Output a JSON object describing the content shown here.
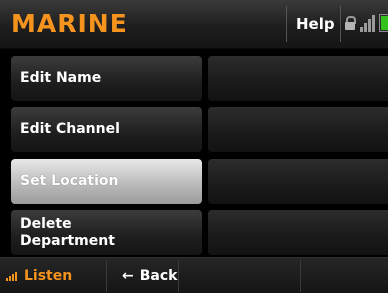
{
  "header": {
    "title": "MARINE",
    "help_label": "Help",
    "status_icons": [
      "lock-icon",
      "signal-icon",
      "battery-icon"
    ],
    "battery_level": 0.85
  },
  "menu": {
    "items": [
      {
        "label": "Edit Name",
        "selected": false
      },
      {
        "label": "Edit Channel",
        "selected": false
      },
      {
        "label": "Set Location",
        "selected": true
      },
      {
        "label": "Delete Department",
        "line1": "Delete",
        "line2": "Department",
        "selected": false
      }
    ]
  },
  "footer": {
    "listen_label": "Listen",
    "back_label": "Back",
    "back_icon": "back-arrow-icon",
    "listen_icon": "signal-bars-icon"
  },
  "colors": {
    "accent": "#f4931e",
    "battery": "#35c11c",
    "background": "#000000"
  }
}
